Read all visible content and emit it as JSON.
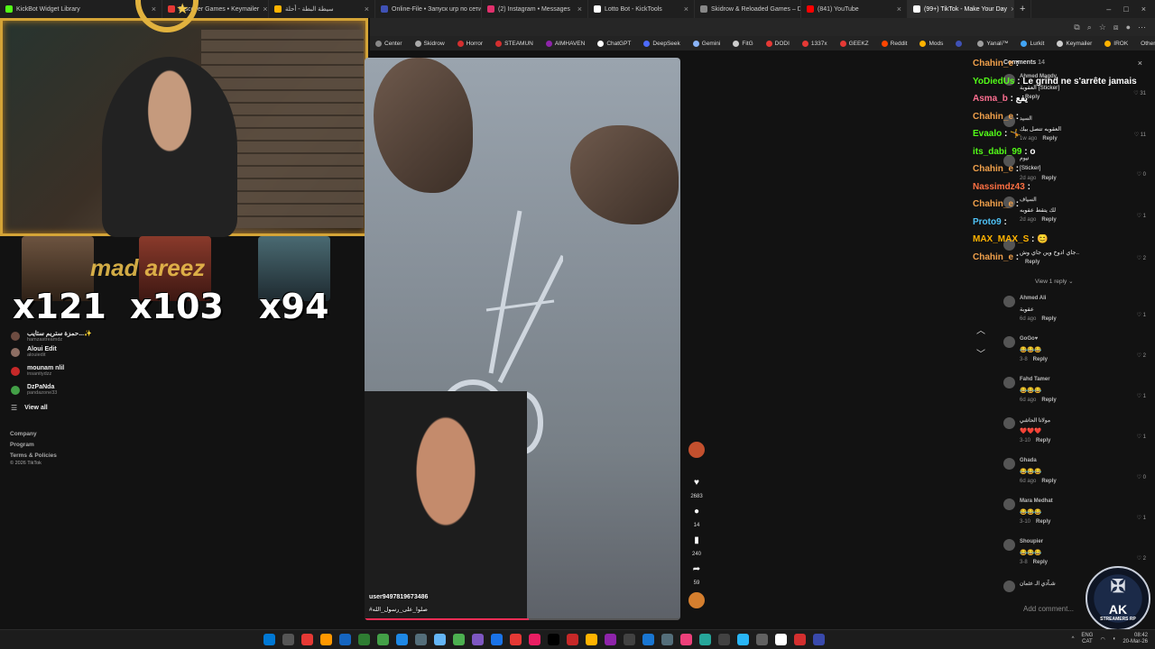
{
  "browser": {
    "tabs": [
      {
        "title": "KickBot Widget Library",
        "color": "#53fc18"
      },
      {
        "title": "Discover Games • Keymailer",
        "color": "#e53935"
      },
      {
        "title": "سيطة البطة - أحلة",
        "color": "#ffb300"
      },
      {
        "title": "Online-File • Запуск urp по сети",
        "color": "#3f51b5"
      },
      {
        "title": "(2) Instagram • Messages",
        "color": "#e1306c"
      },
      {
        "title": "Lotto Bot - KickTools",
        "color": "#ffffff"
      },
      {
        "title": "Skidrow & Reloaded Games – Do...",
        "color": "#888888"
      },
      {
        "title": "(841) YouTube",
        "color": "#ff0000"
      },
      {
        "title": "(99+) TikTok - Make Your Day",
        "color": "#ffffff",
        "active": true
      }
    ],
    "tab_close": "×",
    "new_tab": "+",
    "window_controls": [
      "–",
      "□",
      "×"
    ],
    "bookmarks": [
      {
        "label": "Center",
        "color": "#888"
      },
      {
        "label": "Skidrow",
        "color": "#aaa"
      },
      {
        "label": "Horror",
        "color": "#d32f2f"
      },
      {
        "label": "STEAMUN",
        "color": "#d32f2f"
      },
      {
        "label": "AIMHAVEN",
        "color": "#8e24aa"
      },
      {
        "label": "ChatGPT",
        "color": "#ffffff"
      },
      {
        "label": "DeepSeek",
        "color": "#4d6bfe"
      },
      {
        "label": "Gemini",
        "color": "#8ab4f8"
      },
      {
        "label": "FitG",
        "color": "#ccc"
      },
      {
        "label": "DODI",
        "color": "#e53935"
      },
      {
        "label": "1337x",
        "color": "#e53935"
      },
      {
        "label": "GEEKZ",
        "color": "#e53935"
      },
      {
        "label": "Reddit",
        "color": "#ff4500"
      },
      {
        "label": "Mods",
        "color": "#ffb300"
      },
      {
        "label": "",
        "color": "#3f51b5"
      },
      {
        "label": "Yanali™",
        "color": "#9e9e9e"
      },
      {
        "label": "Lurkit",
        "color": "#42a5f5"
      },
      {
        "label": "Keymailer",
        "color": "#ccc"
      },
      {
        "label": "IROK",
        "color": "#ffb300"
      }
    ],
    "other_favorites": "Other favorites"
  },
  "stream_overlay": {
    "banner_name": "mad          areez",
    "multipliers": [
      "x121",
      "x103",
      "x94"
    ]
  },
  "left_nav": {
    "following": [
      {
        "name": "Aloui Edit",
        "handle": "alouiedit",
        "color": "#8d6e63"
      },
      {
        "name": "mounam nlil",
        "handle": "insanitydzz",
        "color": "#c62828"
      },
      {
        "name": "DzPaNda",
        "handle": "pandazone33",
        "color": "#43a047"
      }
    ],
    "partial_top": "حمزة ستريم ستايب...✨",
    "partial_top_sub": "hamzastreamdz",
    "view_all": "View all",
    "footer_links": [
      "Company",
      "Program",
      "Terms & Policies",
      "© 2026 TikTok"
    ]
  },
  "video": {
    "username": "user9497819673486",
    "caption": "#صلوا_على_رسول_الله",
    "progress_fraction": 0.52,
    "actions": {
      "likes": "2683",
      "comments": "14",
      "saves": "240",
      "shares": "59"
    }
  },
  "chat_overlay": [
    {
      "user": "Chahin_e",
      "msg": "",
      "color": "#f0a04b"
    },
    {
      "user": "YoDiedUs",
      "msg": "Le grind ne s'arrête jamais",
      "color": "#53fc18",
      "badge": "!"
    },
    {
      "user": "Asma_b",
      "msg": "يفع",
      "color": "#ff6f91"
    },
    {
      "user": "Chahin_e",
      "msg": "",
      "color": "#f0a04b"
    },
    {
      "user": "Evaalo",
      "msg": "🤸",
      "color": "#53fc18"
    },
    {
      "user": "its_dabi_99",
      "msg": "o",
      "color": "#53fc18"
    },
    {
      "user": "Chahin_e",
      "msg": "",
      "color": "#f0a04b"
    },
    {
      "user": "Nassimdz43",
      "msg": "",
      "color": "#ff7043"
    },
    {
      "user": "Chahin_e",
      "msg": "",
      "color": "#f0a04b"
    },
    {
      "user": "Proto9",
      "msg": "",
      "color": "#4fc3f7"
    },
    {
      "user": "MAX_MAX_S",
      "msg": "😊",
      "color": "#ffb300"
    },
    {
      "user": "Chahin_e",
      "msg": "",
      "color": "#f0a04b"
    }
  ],
  "comments_panel": {
    "header": "Comments",
    "count": "14",
    "close": "×",
    "view_reply": "View 1 reply ⌄",
    "add_comment": "Add comment...",
    "reply_label": "Reply",
    "items": [
      {
        "name": "Ahmed Magdy",
        "text": "العقوبة [Sticker]",
        "meta": "",
        "likes": "31"
      },
      {
        "name": "السيد",
        "text": "العقوبه تتصل بيك",
        "meta": "1w ago",
        "likes": "11"
      },
      {
        "name": "نيوم",
        "text": "[Sticker]",
        "meta": "2d ago",
        "likes": "0"
      },
      {
        "name": "السياف",
        "text": "لك يتقط عقوبه",
        "meta": "2d ago",
        "likes": "1"
      },
      {
        "name": "",
        "text": "جاي ادوخ وين جاي وش..",
        "meta": "",
        "likes": "2"
      },
      {
        "name": "Ahmed Ali",
        "text": "عقوبة",
        "meta": "6d ago",
        "likes": "1"
      },
      {
        "name": "GoGo♥",
        "text": "😂😂😂",
        "meta": "3-8",
        "likes": "2"
      },
      {
        "name": "Fahd Tamer",
        "text": "😂😂😂",
        "meta": "6d ago",
        "likes": "1"
      },
      {
        "name": "مولانا الحاشي",
        "text": "❤️❤️❤️",
        "meta": "3-10",
        "likes": "1"
      },
      {
        "name": "Ghada",
        "text": "😂😂😂",
        "meta": "6d ago",
        "likes": "0"
      },
      {
        "name": "Mara Medhat",
        "text": "😂😂😂",
        "meta": "3-10",
        "likes": "1"
      },
      {
        "name": "Shoupier",
        "text": "😂😂😂",
        "meta": "3-8",
        "likes": "2"
      },
      {
        "name": "شـآدي الـ عثمان",
        "text": "",
        "meta": "",
        "likes": ""
      }
    ]
  },
  "streamer_logo": {
    "main": "AK",
    "sub": "STREAMERS RP"
  },
  "taskbar": {
    "icons": [
      "#0078d4",
      "#555",
      "#e53935",
      "#ff9800",
      "#1565c0",
      "#2e7d32",
      "#43a047",
      "#1e88e5",
      "#546e7a",
      "#64b5f6",
      "#4caf50",
      "#7e57c2",
      "#1a73e8",
      "#e53935",
      "#e91e63",
      "#000000",
      "#c62828",
      "#ffb300",
      "#8e24aa",
      "#424242",
      "#1976d2",
      "#546e7a",
      "#ec407a",
      "#26a69a",
      "#424242",
      "#29b6f6",
      "#616161",
      "#ffffff",
      "#d32f2f",
      "#3949ab"
    ],
    "lang_top": "ENG",
    "lang_bottom": "CAT",
    "time": "08:42",
    "date": "20-Mar-26"
  }
}
